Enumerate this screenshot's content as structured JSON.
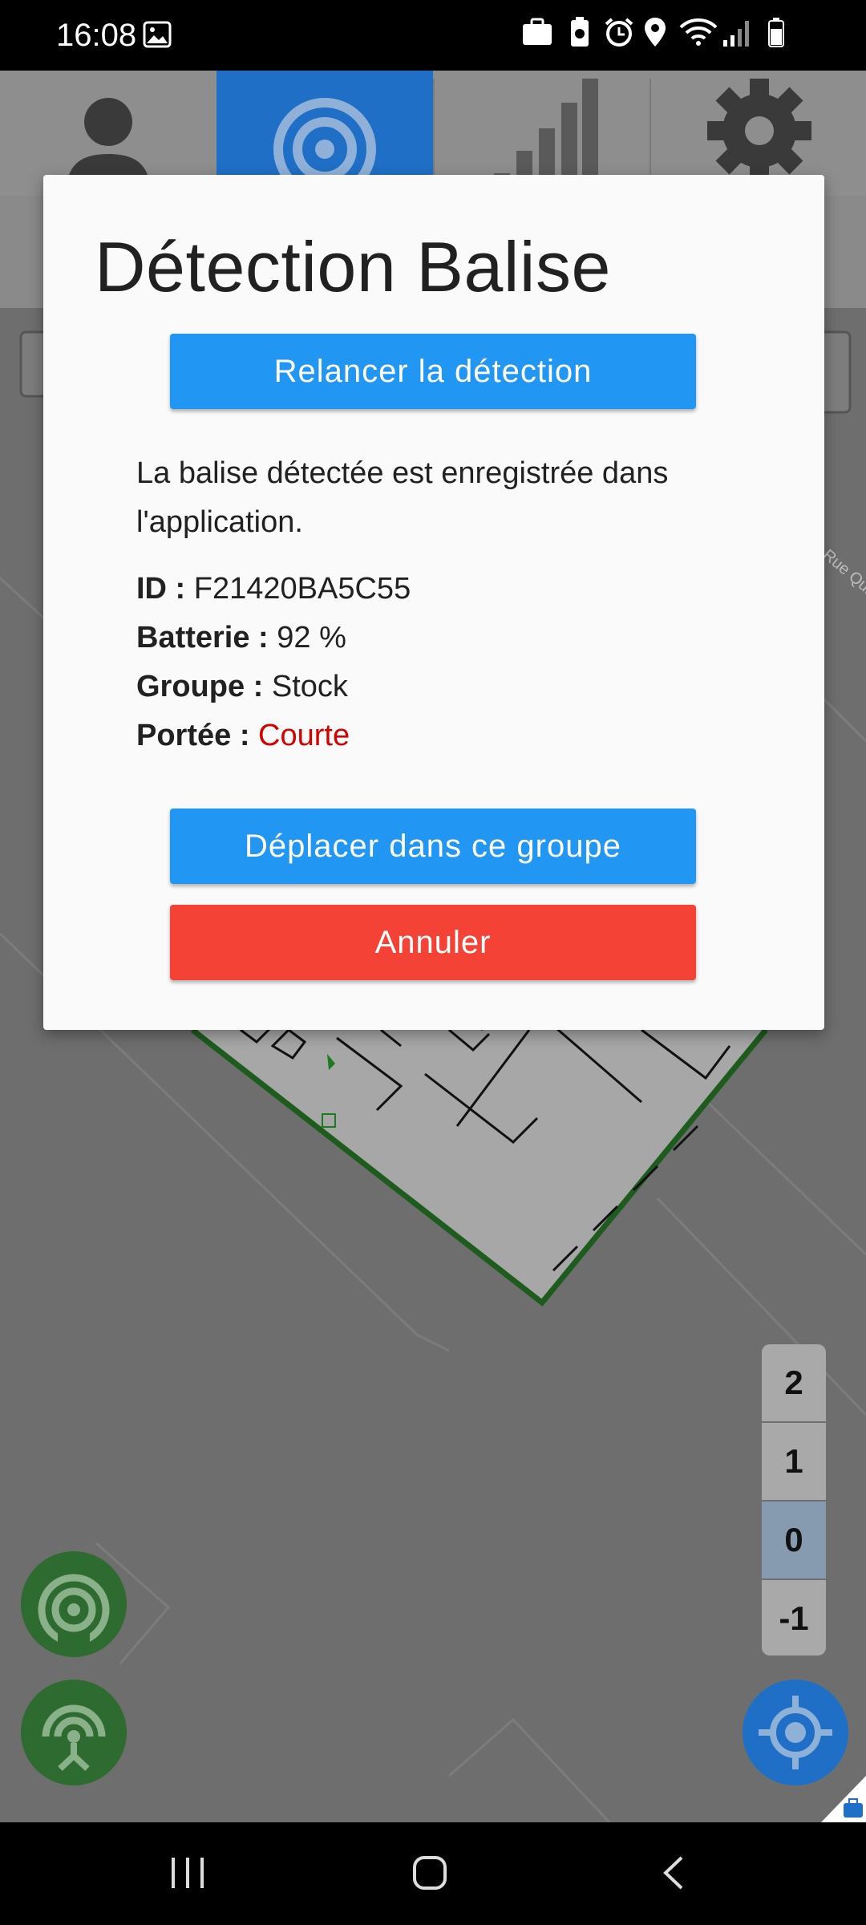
{
  "status_bar": {
    "time": "16:08"
  },
  "dialog": {
    "title": "Détection Balise",
    "relaunch_button": "Relancer la détection",
    "message": "La balise détectée est enregistrée dans l'application.",
    "fields": [
      {
        "label": "ID :",
        "value": "F21420BA5C55"
      },
      {
        "label": "Batterie :",
        "value": "92 %"
      },
      {
        "label": "Groupe :",
        "value": "Stock"
      },
      {
        "label": "Portée :",
        "value": "Courte"
      }
    ],
    "move_button": "Déplacer dans ce groupe",
    "cancel_button": "Annuler"
  },
  "map": {
    "street_label": "Rue Qui"
  },
  "floors": [
    {
      "label": "2",
      "active": false
    },
    {
      "label": "1",
      "active": false
    },
    {
      "label": "0",
      "active": true
    },
    {
      "label": "-1",
      "active": false
    }
  ],
  "tabs": [
    "user-icon",
    "beacon-icon",
    "signal-bars-icon",
    "gear-icon"
  ],
  "colors": {
    "primary": "#2196f3",
    "danger": "#f44336",
    "range_short": "#d50000",
    "fab_green": "#2e6b30",
    "fab_blue": "#1f6fc6"
  }
}
